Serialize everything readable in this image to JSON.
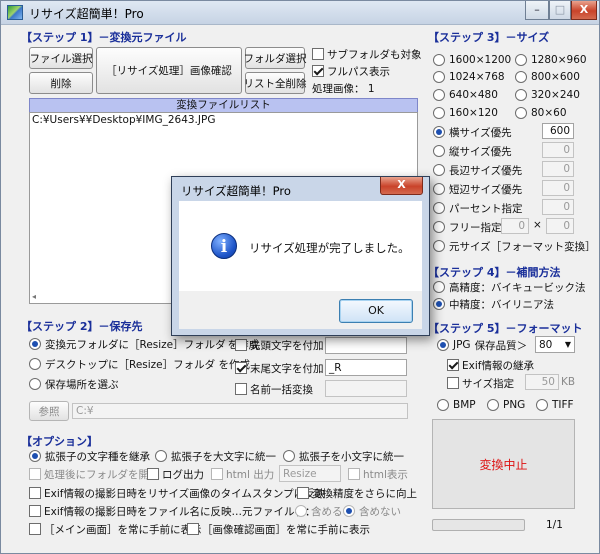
{
  "window": {
    "title": "リサイズ超簡単！Pro",
    "minimize": "–",
    "maximize": "□",
    "close": "X"
  },
  "step1": {
    "title": "【ステップ 1】－変換元ファイル",
    "file_select": "ファイル選択",
    "delete": "削除",
    "resize_confirm": "［リサイズ処理］画像確認",
    "folder_select": "フォルダ選択",
    "clear_all": "リスト全削除",
    "subfolder_label": "サブフォルダも対象",
    "subfolder_checked": false,
    "fullpath_label": "フルパス表示",
    "fullpath_checked": true,
    "processed_label": "処理画像：",
    "processed_count": "1",
    "list_header": "変換ファイルリスト",
    "files": [
      "C:¥Users¥¥Desktop¥IMG_2643.JPG"
    ]
  },
  "step2": {
    "title": "【ステップ 2】－保存先",
    "opt1": "変換元フォルダに［Resize］フォルダ",
    "opt1_tail": "を作成",
    "opt2": "デスクトップに［Resize］フォルダ を作成",
    "opt3": "保存場所を選ぶ",
    "prefix_label": "先頭文字を付加",
    "suffix_label": "末尾文字を付加",
    "suffix_value": "_R",
    "rename_label": "名前一括変換",
    "browse": "参照",
    "path_value": "C:¥"
  },
  "step3": {
    "title": "【ステップ 3】－サイズ",
    "sizes": [
      "1600×1200",
      "1280×960",
      "1024×768",
      "800×600",
      "640×480",
      "320×240",
      "160×120",
      "80×60"
    ],
    "width_priority": "横サイズ優先",
    "width_value": "600",
    "height_priority": "縦サイズ優先",
    "long_side": "長辺サイズ優先",
    "short_side": "短辺サイズ優先",
    "percent": "パーセント指定",
    "free": "フリー指定",
    "times": "×",
    "original": "元サイズ［フォーマット変換］",
    "zero": "0"
  },
  "step4": {
    "title": "【ステップ 4】－補間方法",
    "high": "高精度：バイキュービック法",
    "mid": "中精度：バイリニア法"
  },
  "step5": {
    "title": "【ステップ 5】－フォーマット",
    "jpg": "JPG",
    "quality_label": "保存品質＞",
    "quality_value": "80",
    "exif": "Exif情報の継承",
    "size_spec": "サイズ指定",
    "size_value": "50",
    "size_unit": "KB",
    "bmp": "BMP",
    "png": "PNG",
    "tiff": "TIFF"
  },
  "options": {
    "title": "【オプション】",
    "ext_keep": "拡張子の文字種を継承",
    "ext_upper": "拡張子を大文字に統一",
    "ext_lower": "拡張子を小文字に統一",
    "open_folder": "処理後にフォルダを開く",
    "log_output": "ログ出力",
    "html_output": "html 出力",
    "resize_field": "Resize",
    "html_display": "html表示",
    "exif_timestamp": "Exif情報の撮影日時をリサイズ画像のタイムスタンプに反映",
    "precision_up": "変換精度をさらに向上",
    "exif_filename": "Exif情報の撮影日時をファイル名に反映…元ファイル名：",
    "include": "含める",
    "exclude": "含めない",
    "main_top": "［メイン画面］を常に手前に表示",
    "confirm_top": "［画像確認画面］を常に手前に表示"
  },
  "action": {
    "stop": "変換中止",
    "progress_text": "1/1",
    "progress": 0
  },
  "dialog": {
    "title": "リサイズ超簡単！Pro",
    "message": "リサイズ処理が完了しました。",
    "ok": "OK",
    "close": "X"
  },
  "colors": {
    "section": "#1a2f9a",
    "list_header": "#b9c2f1",
    "stop_text": "#dd1111"
  }
}
